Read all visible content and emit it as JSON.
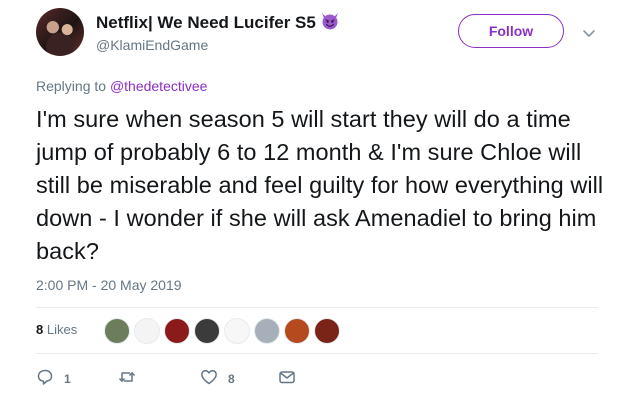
{
  "author": {
    "display_name": "Netflix| We Need Lucifer S5",
    "emoji": "smiling-devil-emoji",
    "handle": "@KlamiEndGame"
  },
  "follow_label": "Follow",
  "replying": {
    "prefix": "Replying to",
    "mention": "@thedetectivee"
  },
  "tweet_text": "I'm sure when season 5 will start they will do a time jump of probably 6 to 12 month & I'm sure Chloe will still be miserable and feel guilty for how everything will down - I wonder if she will ask Amenadiel to bring him back?",
  "timestamp": "2:00 PM - 20 May 2019",
  "likes": {
    "count": "8",
    "label": "Likes"
  },
  "liker_avatar_colors": [
    "#6b7d5a",
    "#f4f4f4",
    "#8b1a1a",
    "#3b3b3b",
    "#f7f7f7",
    "#a7b0ba",
    "#b44a1e",
    "#7a2418"
  ],
  "actions": {
    "reply_count": "1",
    "retweet_count": "",
    "like_count": "8"
  },
  "colors": {
    "accent": "#8c2fc3",
    "secondary_text": "#657786",
    "divider": "#e6ecf0"
  }
}
